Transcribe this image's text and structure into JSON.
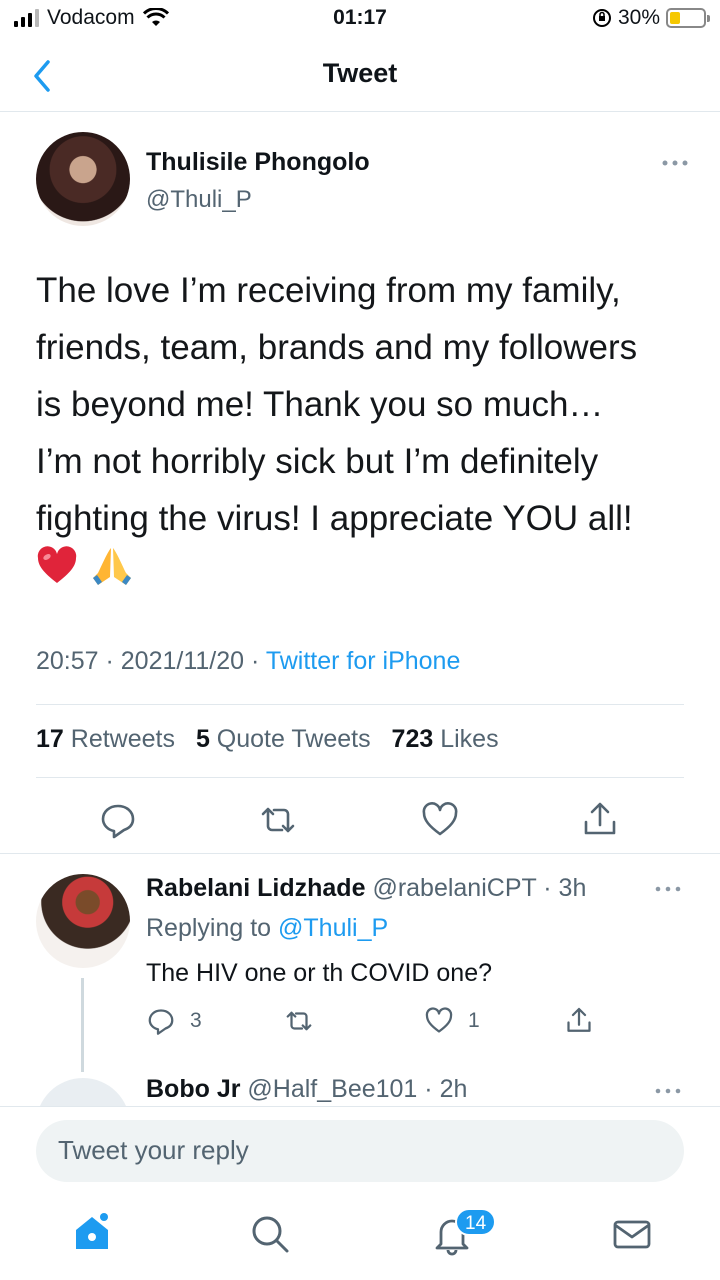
{
  "status_bar": {
    "carrier": "Vodacom",
    "time": "01:17",
    "battery": "30%",
    "battery_level": 0.3
  },
  "nav": {
    "title": "Tweet"
  },
  "tweet": {
    "author_name": "Thulisile Phongolo",
    "author_handle": "@Thuli_P",
    "text_lines": [
      "The love I’m receiving from my family,",
      "friends, team, brands and my followers",
      "is beyond me! Thank you so much…",
      "I’m not horribly sick but I’m definitely",
      "fighting the virus! I appreciate YOU all!"
    ],
    "emojis": [
      "heart-emoji",
      "folded-hands-emoji"
    ],
    "time": "20:57",
    "date": "2021/11/20",
    "source": "Twitter for iPhone",
    "stats": {
      "retweets_count": "17",
      "retweets_label": "Retweets",
      "quotes_count": "5",
      "quotes_label": "Quote Tweets",
      "likes_count": "723",
      "likes_label": "Likes"
    }
  },
  "replies": [
    {
      "name": "Rabelani Lidzhade",
      "handle": "@rabelaniCPT",
      "age": "3h",
      "replying_prefix": "Replying to",
      "replying_to": "@Thuli_P",
      "text": "The HIV one or th COVID one?",
      "reply_count": "3",
      "like_count": "1"
    },
    {
      "name": "Bobo Jr",
      "handle": "@Half_Bee101",
      "age": "2h"
    }
  ],
  "compose": {
    "placeholder": "Tweet your reply"
  },
  "tabbar": {
    "notifications_badge": "14"
  },
  "colors": {
    "accent": "#1d9bf0",
    "secondary_text": "#536471",
    "divider": "#e1e8ed"
  }
}
